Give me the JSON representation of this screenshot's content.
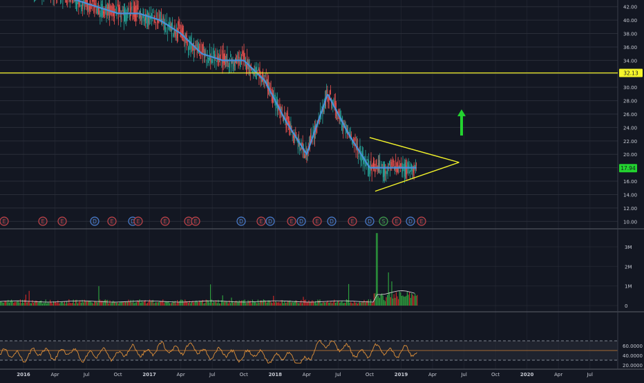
{
  "colors": {
    "background": "#131722",
    "grid": "#2a2e39",
    "axis_text": "#c8cbd4",
    "up": "#26a69a",
    "down": "#ef5350",
    "ma": "#4a90d9",
    "volume_up": "#2e9e3e",
    "volume_down": "#c62828",
    "rsi": "#e0913a",
    "pattern": "#f5f52a",
    "arrow": "#23d32f",
    "price_tag": "#23d32f",
    "level_tag": "#f5f52a"
  },
  "price_axis": {
    "ticks": [
      "10.00",
      "12.00",
      "14.00",
      "16.00",
      "18.00",
      "20.00",
      "22.00",
      "24.00",
      "26.00",
      "28.00",
      "30.00",
      "32.00",
      "34.00",
      "36.00",
      "38.00",
      "40.00",
      "42.00"
    ]
  },
  "volume_axis": {
    "ticks": [
      "0",
      "1M",
      "2M",
      "3M"
    ]
  },
  "rsi_axis": {
    "ticks": [
      "20.0000",
      "40.0000",
      "60.0000"
    ]
  },
  "time_axis": {
    "labels": [
      "2016",
      "Apr",
      "Jul",
      "Oct",
      "2017",
      "Apr",
      "Jul",
      "Oct",
      "2018",
      "Apr",
      "Jul",
      "Oct",
      "2019",
      "Apr",
      "Jul",
      "Oct",
      "2020",
      "Apr",
      "Jul"
    ]
  },
  "tags": {
    "last_price": "17.94",
    "resistance": "32.13"
  },
  "events": [
    "E",
    "E",
    "E",
    "D",
    "E",
    "D",
    "E",
    "E",
    "E",
    "E",
    "D",
    "E",
    "D",
    "E",
    "D",
    "E",
    "D",
    "E",
    "D",
    "S",
    "E",
    "D",
    "E"
  ],
  "chart_data": [
    {
      "type": "candlestick",
      "x": [
        "2015-12",
        "2016-02",
        "2016-04",
        "2016-06",
        "2016-08",
        "2016-10",
        "2016-12",
        "2017-02",
        "2017-04",
        "2017-06",
        "2017-08",
        "2017-10",
        "2017-12",
        "2018-02",
        "2018-04",
        "2018-06",
        "2018-08",
        "2018-10",
        "2018-12",
        "2019-02"
      ],
      "values": [
        46,
        45,
        44,
        43,
        42,
        41,
        41,
        40,
        38,
        35,
        34,
        34,
        31,
        25,
        20,
        29,
        23,
        18,
        18,
        18
      ],
      "moving_average": true,
      "ylim": [
        9,
        43
      ],
      "annotations": {
        "horizontal_level": 32.13,
        "last_price": 17.94,
        "triangle": {
          "upper_start": [
            "2018-10",
            22.5
          ],
          "lower_start": [
            "2018-10",
            14.5
          ],
          "apex": [
            "2019-06",
            18.8
          ]
        },
        "arrow": "up"
      }
    },
    {
      "type": "bar",
      "name": "Volume",
      "ylim": [
        0,
        3600000
      ],
      "typical": 200000,
      "peak": 3700000
    },
    {
      "type": "line",
      "name": "RSI",
      "ylim": [
        15,
        78
      ],
      "bands": [
        30,
        50,
        70
      ],
      "x": [
        "2015-12",
        "2016-04",
        "2016-08",
        "2016-12",
        "2017-04",
        "2017-08",
        "2017-12",
        "2018-04",
        "2018-06",
        "2018-08",
        "2018-12",
        "2019-02"
      ],
      "values": [
        40,
        45,
        40,
        48,
        55,
        42,
        40,
        30,
        72,
        45,
        50,
        43
      ]
    }
  ]
}
